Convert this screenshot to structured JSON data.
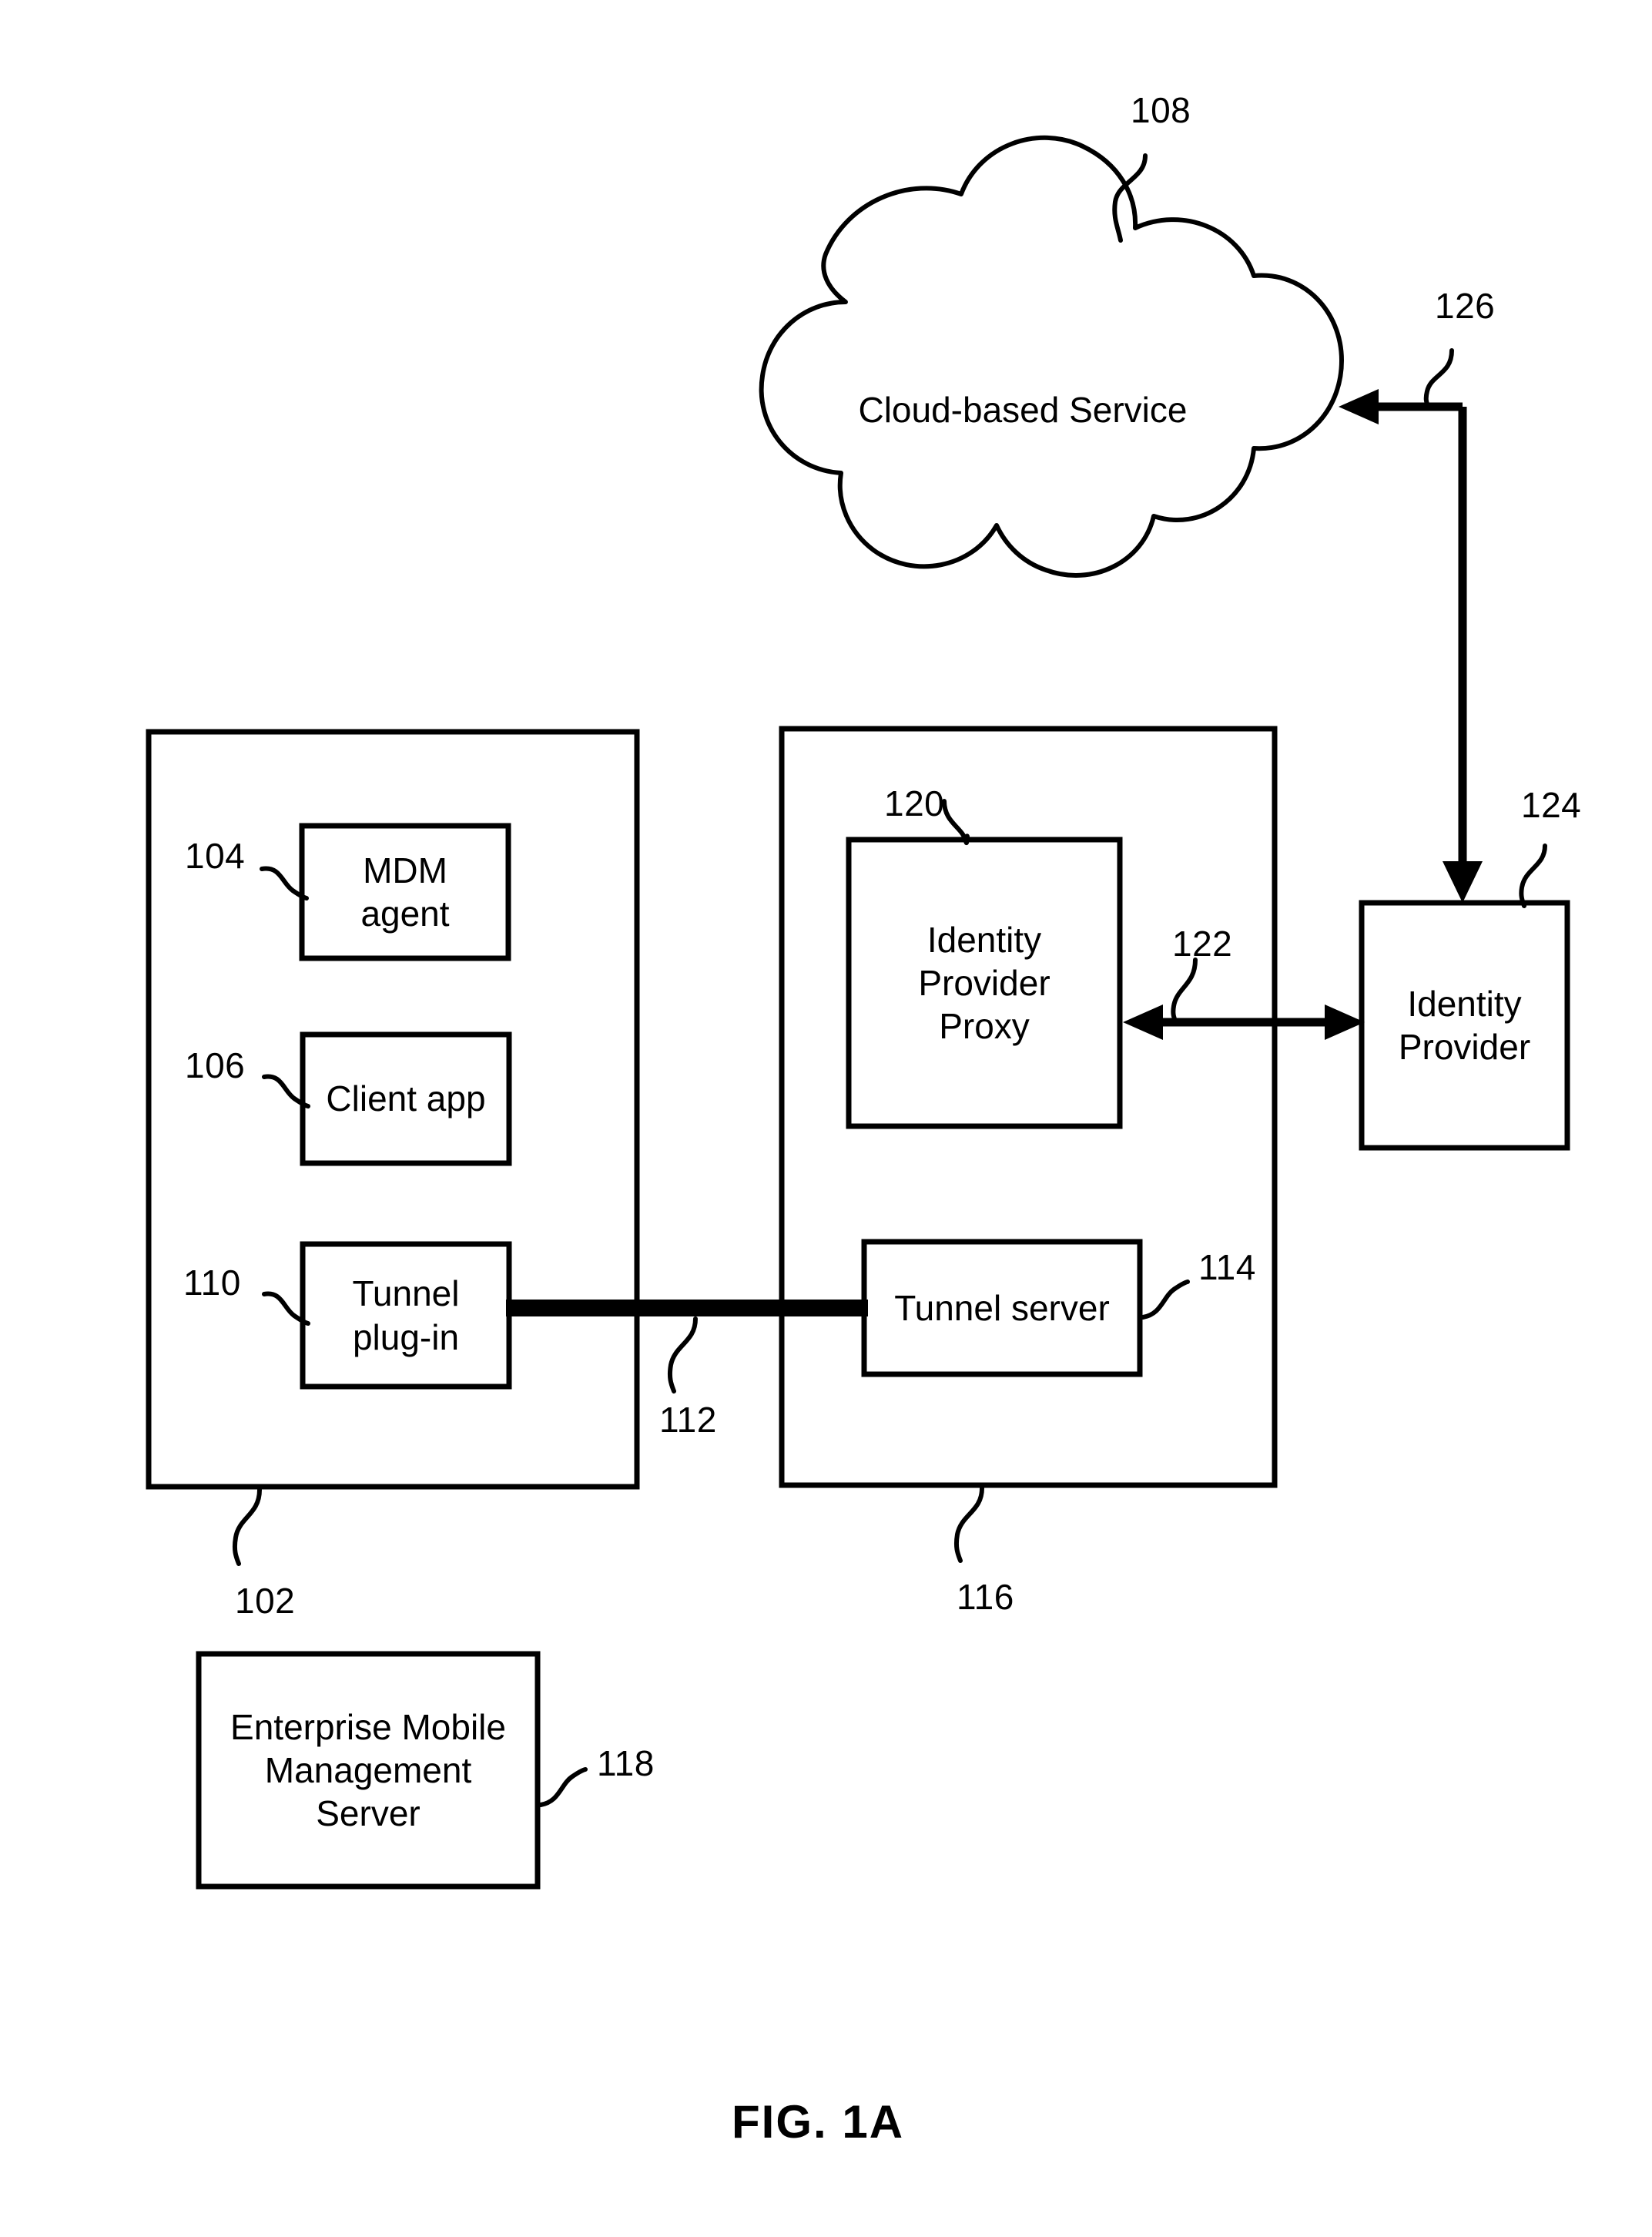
{
  "figure": {
    "caption": "FIG. 1A",
    "type": "patent-block-diagram"
  },
  "cloud": {
    "label": "Cloud-based Service",
    "ref": "108"
  },
  "containers": [
    {
      "id": "device",
      "ref": "102"
    },
    {
      "id": "gateway",
      "ref": "116"
    }
  ],
  "blocks": {
    "mdm_agent": {
      "label": "MDM\nagent",
      "line1": "MDM",
      "line2": "agent",
      "ref": "104"
    },
    "client_app": {
      "label": "Client app",
      "ref": "106"
    },
    "tunnel_plugin": {
      "line1": "Tunnel",
      "line2": "plug-in",
      "ref": "110"
    },
    "tunnel_server": {
      "label": "Tunnel server",
      "ref": "114"
    },
    "identity_provider_proxy": {
      "line1": "Identity",
      "line2": "Provider",
      "line3": "Proxy",
      "ref": "120"
    },
    "identity_provider": {
      "line1": "Identity",
      "line2": "Provider",
      "ref": "124"
    },
    "emm_server": {
      "line1": "Enterprise Mobile",
      "line2": "Management",
      "line3": "Server",
      "ref": "118"
    }
  },
  "connectors": {
    "tunnel": {
      "ref": "112",
      "style": "thick-line"
    },
    "idp_proxy_to_idp": {
      "ref": "122",
      "style": "double-arrow"
    },
    "idp_to_cloud": {
      "ref": "126",
      "style": "elbow-arrow"
    }
  },
  "colors": {
    "ink": "#000000",
    "paper": "#ffffff"
  }
}
